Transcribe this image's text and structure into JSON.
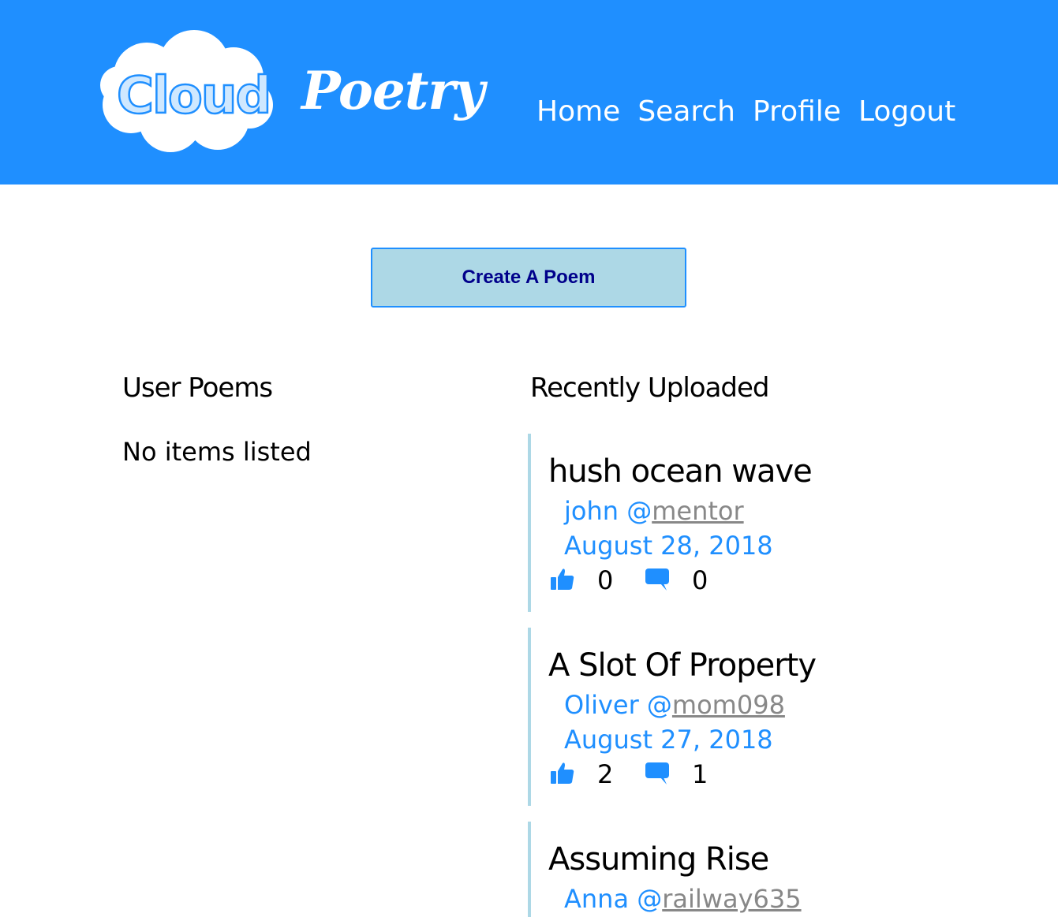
{
  "logo": {
    "part1": "Cloud",
    "part2": "Poetry"
  },
  "nav": {
    "items": [
      "Home",
      "Search",
      "Profile",
      "Logout"
    ]
  },
  "create_button": "Create A Poem",
  "user_poems": {
    "title": "User Poems",
    "empty_message": "No items listed"
  },
  "recent": {
    "title": "Recently Uploaded",
    "poems": [
      {
        "title": "hush ocean wave",
        "author": "john",
        "at": "@",
        "handle": "mentor",
        "date": "August 28, 2018",
        "likes": "0",
        "comments": "0"
      },
      {
        "title": "A Slot Of Property",
        "author": "Oliver",
        "at": "@",
        "handle": "mom098",
        "date": "August 27, 2018",
        "likes": "2",
        "comments": "1"
      },
      {
        "title": "Assuming Rise",
        "author": "Anna",
        "at": "@",
        "handle": "railway635",
        "date": "",
        "likes": "",
        "comments": ""
      }
    ]
  },
  "colors": {
    "header_bg": "#1f8fff",
    "button_bg": "#add8e6",
    "button_text": "#00008b",
    "link_blue": "#1f8fff",
    "handle_gray": "#888888"
  },
  "icons": {
    "like": "thumbs-up-icon",
    "comment": "speech-bubble-icon"
  }
}
